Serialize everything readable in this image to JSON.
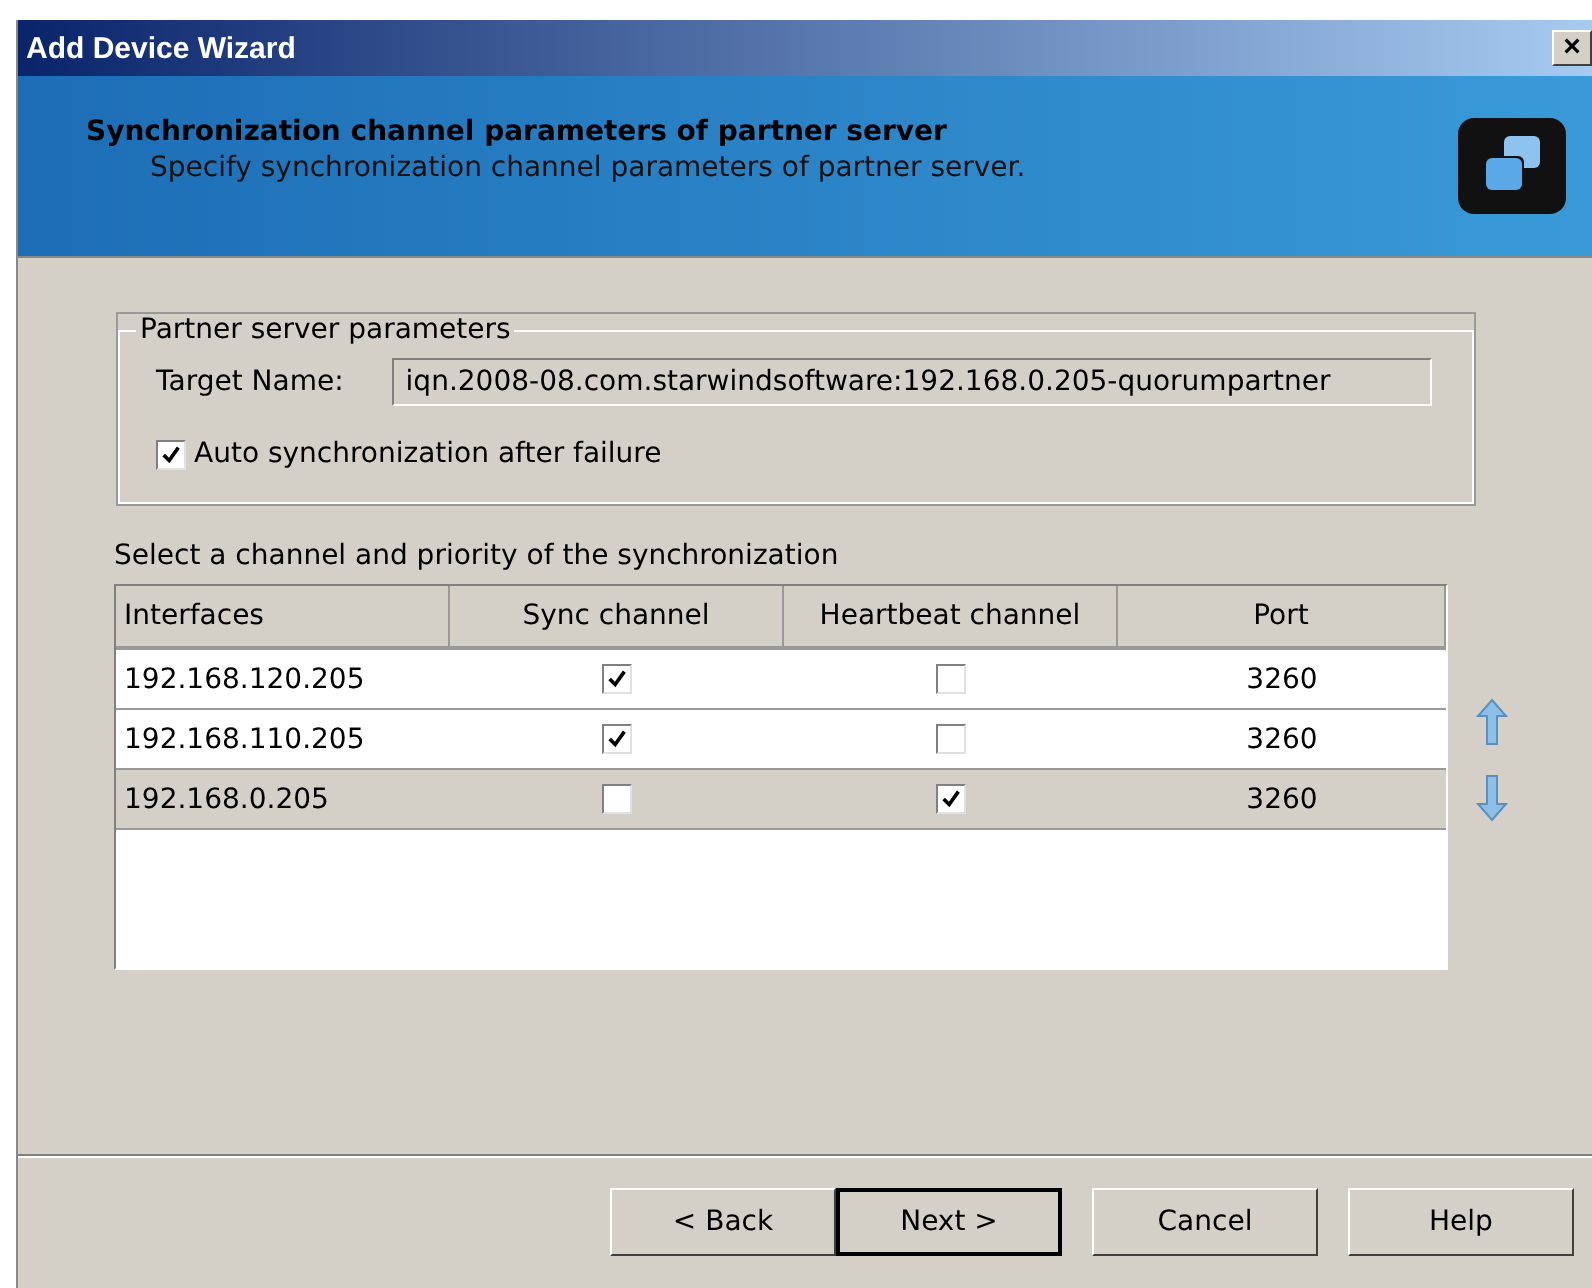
{
  "window": {
    "title": "Add Device Wizard",
    "close": "×"
  },
  "header": {
    "title": "Synchronization channel parameters of partner server",
    "subtitle": "Specify synchronization channel parameters of partner server."
  },
  "group": {
    "legend": "Partner server parameters",
    "target_label": "Target Name:",
    "target_value": "iqn.2008-08.com.starwindsoftware:192.168.0.205-quorumpartner",
    "auto_sync": {
      "label": "Auto synchronization after failure",
      "checked": true
    }
  },
  "table_caption": "Select a channel and priority of the synchronization",
  "table": {
    "columns": [
      "Interfaces",
      "Sync channel",
      "Heartbeat channel",
      "Port"
    ],
    "rows": [
      {
        "interface": "192.168.120.205",
        "sync": true,
        "heartbeat": false,
        "port": "3260",
        "selected": false
      },
      {
        "interface": "192.168.110.205",
        "sync": true,
        "heartbeat": false,
        "port": "3260",
        "selected": false
      },
      {
        "interface": "192.168.0.205",
        "sync": false,
        "heartbeat": true,
        "port": "3260",
        "selected": true
      }
    ]
  },
  "buttons": [
    {
      "label": "< Back",
      "default": false
    },
    {
      "label": "Next >",
      "default": true
    },
    {
      "label": "Cancel",
      "default": false
    },
    {
      "label": "Help",
      "default": false
    }
  ]
}
